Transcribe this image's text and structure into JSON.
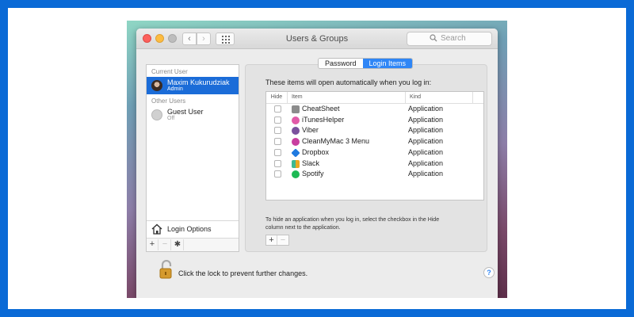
{
  "window": {
    "title": "Users & Groups",
    "search_placeholder": "Search"
  },
  "sidebar": {
    "current_user_heading": "Current User",
    "current_user": {
      "name": "Maxim Kukurudziak",
      "role": "Admin"
    },
    "other_users_heading": "Other Users",
    "other_users": [
      {
        "name": "Guest User",
        "status": "Off"
      }
    ],
    "login_options_label": "Login Options",
    "toolbar": {
      "add": "+",
      "remove": "−",
      "gear": "✱"
    }
  },
  "tabs": [
    {
      "label": "Password",
      "active": false
    },
    {
      "label": "Login Items",
      "active": true
    }
  ],
  "login_items": {
    "intro": "These items will open automatically when you log in:",
    "columns": {
      "hide": "Hide",
      "item": "Item",
      "kind": "Kind"
    },
    "rows": [
      {
        "name": "CheatSheet",
        "kind": "Application",
        "icon": "cheatsheet-icon",
        "color": "#8c8c8c"
      },
      {
        "name": "iTunesHelper",
        "kind": "Application",
        "icon": "itunes-icon",
        "color": "#e25aa8"
      },
      {
        "name": "Viber",
        "kind": "Application",
        "icon": "viber-icon",
        "color": "#7b519d"
      },
      {
        "name": "CleanMyMac 3 Menu",
        "kind": "Application",
        "icon": "cleanmymac-icon",
        "color": "#c83fa0"
      },
      {
        "name": "Dropbox",
        "kind": "Application",
        "icon": "dropbox-icon",
        "color": "#1f7ae0"
      },
      {
        "name": "Slack",
        "kind": "Application",
        "icon": "slack-icon",
        "color": "#3eb991"
      },
      {
        "name": "Spotify",
        "kind": "Application",
        "icon": "spotify-icon",
        "color": "#1db954"
      }
    ],
    "help_line1": "To hide an application when you log in, select the checkbox in the Hide",
    "help_line2": "column next to the application.",
    "toolbar": {
      "add": "+",
      "remove": "−"
    }
  },
  "footer": {
    "lock_text": "Click the lock to prevent further changes.",
    "help": "?"
  },
  "colors": {
    "selection": "#1b6cd8",
    "accent": "#2f86f6",
    "frame": "#0a6ad6"
  }
}
